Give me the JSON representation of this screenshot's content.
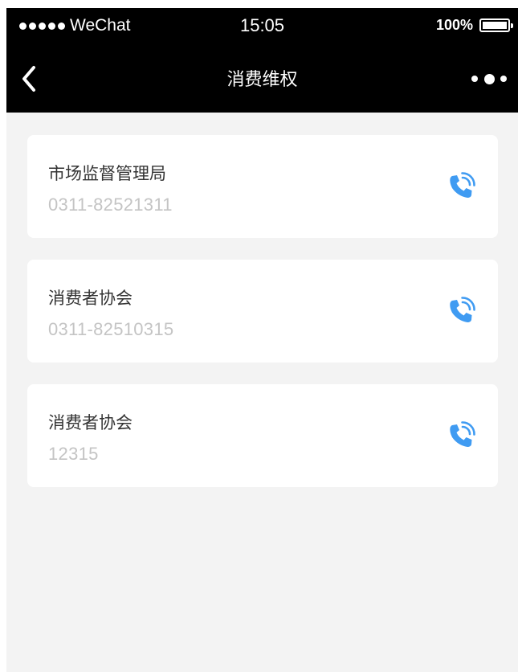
{
  "status_bar": {
    "carrier": "WeChat",
    "time": "15:05",
    "battery": "100%"
  },
  "nav": {
    "title": "消费维权"
  },
  "contacts": [
    {
      "name": "市场监督管理局",
      "phone": "0311-82521311"
    },
    {
      "name": "消费者协会",
      "phone": "0311-82510315"
    },
    {
      "name": "消费者协会",
      "phone": "12315"
    }
  ],
  "colors": {
    "accent": "#3f9bf2",
    "background": "#f3f3f3",
    "card": "#ffffff",
    "header": "#000000"
  },
  "icons": {
    "call": "phone-call-icon",
    "back": "back-chevron-icon",
    "more": "more-dots-icon"
  }
}
